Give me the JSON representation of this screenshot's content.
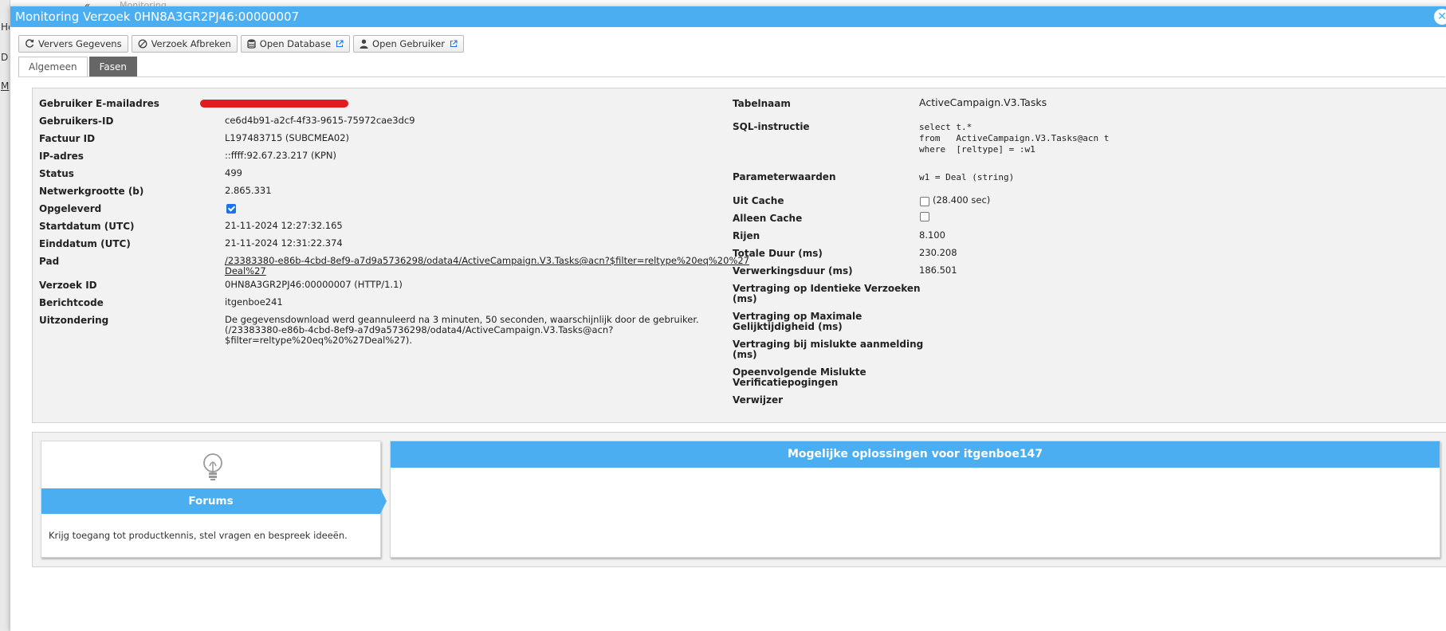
{
  "background": {
    "left_items": [
      "He",
      "D",
      "M"
    ],
    "top_text": "Monitoring"
  },
  "dialog": {
    "title": "Monitoring Verzoek 0HN8A3GR2PJ46:00000007",
    "close_icon": "close-icon"
  },
  "toolbar": {
    "refresh_label": "Ververs Gegevens",
    "abort_label": "Verzoek Afbreken",
    "open_db_label": "Open Database",
    "open_user_label": "Open Gebruiker"
  },
  "tabs": [
    {
      "label": "Algemeen",
      "active": false
    },
    {
      "label": "Fasen",
      "active": true
    }
  ],
  "left_fields": {
    "email": {
      "label": "Gebruiker E-mailadres",
      "value": ""
    },
    "user_id": {
      "label": "Gebruikers-ID",
      "value": "ce6d4b91-a2cf-4f33-9615-75972cae3dc9"
    },
    "invoice": {
      "label": "Factuur ID",
      "value": "L197483715 (SUBCMEA02)"
    },
    "ip": {
      "label": "IP-adres",
      "value": "::ffff:92.67.23.217 (KPN)"
    },
    "status": {
      "label": "Status",
      "value": "499"
    },
    "network": {
      "label": "Netwerkgrootte (b)",
      "value": "2.865.331"
    },
    "delivered": {
      "label": "Opgeleverd",
      "checked": true
    },
    "start": {
      "label": "Startdatum (UTC)",
      "value": "21-11-2024 12:27:32.165"
    },
    "end": {
      "label": "Einddatum (UTC)",
      "value": "21-11-2024 12:31:22.374"
    },
    "path": {
      "label": "Pad",
      "line1": "/23383380-e86b-4cbd-8ef9-a7d9a5736298/odata4/ActiveCampaign.V3.Tasks@acn?$filter=reltype%20eq%20%27",
      "line2": "Deal%27"
    },
    "request_id": {
      "label": "Verzoek ID",
      "value": "0HN8A3GR2PJ46:00000007 (HTTP/1.1)"
    },
    "message_code": {
      "label": "Berichtcode",
      "value": "itgenboe241"
    },
    "exception": {
      "label": "Uitzondering",
      "line1": "De gegevensdownload werd geannuleerd na 3 minuten, 50 seconden, waarschijnlijk door de gebruiker.",
      "line2": "(/23383380-e86b-4cbd-8ef9-a7d9a5736298/odata4/ActiveCampaign.V3.Tasks@acn?",
      "line3": "$filter=reltype%20eq%20%27Deal%27)."
    }
  },
  "right_fields": {
    "table": {
      "label": "Tabelnaam",
      "value": "ActiveCampaign.V3.Tasks"
    },
    "sql": {
      "label": "SQL-instructie",
      "line1": "select t.*",
      "line2": "from   ActiveCampaign.V3.Tasks@acn t",
      "line3": "where  [reltype] = :w1"
    },
    "params": {
      "label": "Parameterwaarden",
      "value": "w1 = Deal (string)"
    },
    "from_cache": {
      "label": "Uit Cache",
      "checked": false,
      "value": "(28.400 sec)"
    },
    "cache_only": {
      "label": "Alleen Cache",
      "checked": false
    },
    "rows": {
      "label": "Rijen",
      "value": "8.100"
    },
    "total_duration": {
      "label": "Totale Duur (ms)",
      "value": "230.208"
    },
    "processing": {
      "label": "Verwerkingsduur (ms)",
      "value": "186.501"
    },
    "delay_identical": {
      "label1": "Vertraging op Identieke Verzoeken",
      "label2": "(ms)"
    },
    "delay_max": {
      "label1": "Vertraging op Maximale",
      "label2": "Gelijktijdigheid (ms)"
    },
    "delay_failed": {
      "label1": "Vertraging bij mislukte aanmelding",
      "label2": "(ms)"
    },
    "consecutive": {
      "label1": "Opeenvolgende Mislukte",
      "label2": "Verificatiepogingen"
    },
    "remover": {
      "label": "Verwijzer"
    }
  },
  "forums": {
    "icon": "lightbulb-icon",
    "title": "Forums",
    "description": "Krijg toegang tot productkennis, stel vragen en bespreek ideeën."
  },
  "solutions": {
    "title": "Mogelijke oplossingen voor itgenboe147"
  },
  "colors": {
    "accent": "#4aaef0",
    "active_tab": "#666666",
    "redaction": "#e21c1c"
  }
}
